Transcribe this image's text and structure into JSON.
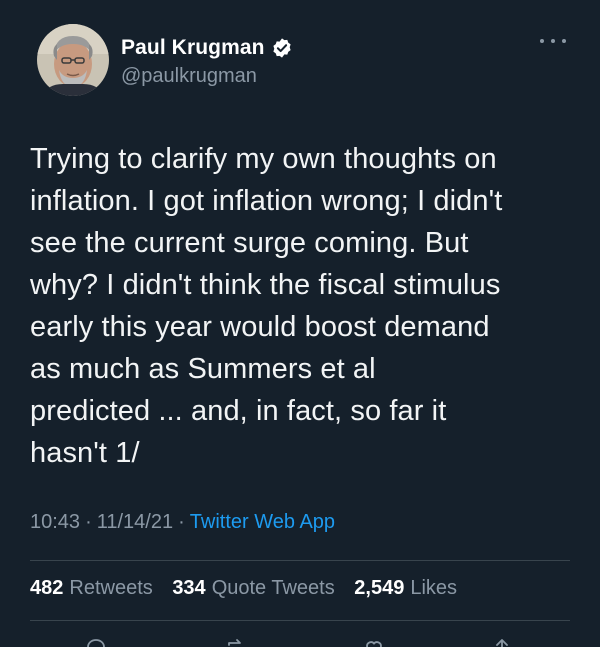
{
  "author": {
    "display_name": "Paul Krugman",
    "handle": "@paulkrugman",
    "verified": true
  },
  "tweet": {
    "lines": [
      "Trying to clarify my own thoughts on",
      "inflation. I got inflation wrong; I didn't",
      "see the current surge coming. But",
      "why? I didn't think the fiscal stimulus",
      "early this year would boost demand",
      "as much as Summers et al",
      "predicted ... and, in fact, so far it",
      "hasn't 1/"
    ]
  },
  "meta": {
    "time": "10:43",
    "date": "11/14/21",
    "separator": "·",
    "source": "Twitter Web App"
  },
  "stats": {
    "retweets_count": "482",
    "retweets_label": "Retweets",
    "quote_tweets_count": "334",
    "quote_tweets_label": "Quote Tweets",
    "likes_count": "2,549",
    "likes_label": "Likes"
  },
  "colors": {
    "background": "#15202b",
    "secondary_text": "#8b98a5",
    "link": "#1d9bf0",
    "divider": "#38444d"
  },
  "icons": {
    "more": "more-horizontal-icon",
    "verified": "verified-badge-icon",
    "reply": "reply-icon",
    "retweet": "retweet-icon",
    "like": "heart-icon",
    "share": "share-icon"
  }
}
